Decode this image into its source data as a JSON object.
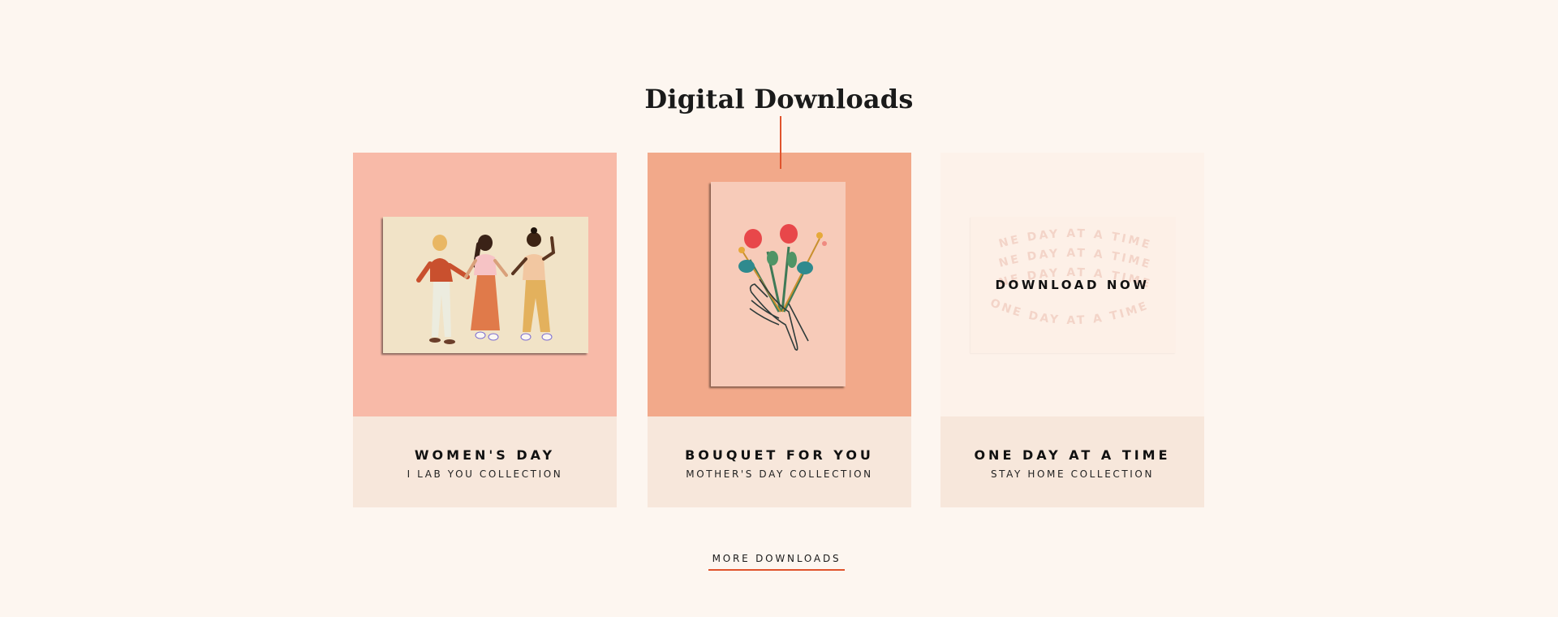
{
  "section": {
    "title": "Digital Downloads"
  },
  "cards": [
    {
      "title": "WOMEN'S DAY",
      "subtitle": "I LAB YOU COLLECTION",
      "illustration": "three-women-dancing",
      "media_bg": "#f8baa8"
    },
    {
      "title": "BOUQUET FOR YOU",
      "subtitle": "MOTHER'S DAY COLLECTION",
      "illustration": "hand-holding-bouquet",
      "media_bg": "#f2a98a"
    },
    {
      "title": "ONE DAY AT A TIME",
      "subtitle": "STAY HOME COLLECTION",
      "overlay_label": "DOWNLOAD NOW",
      "art_text": "ONE DAY AT A TIME,",
      "illustration": "one-day-at-a-time-lettering",
      "media_bg": "#fdf2ea"
    }
  ],
  "more_link": {
    "label": "MORE DOWNLOADS"
  },
  "colors": {
    "accent": "#e0532c",
    "page_bg": "#fdf6f0",
    "caption_bg": "#f7e7db"
  }
}
